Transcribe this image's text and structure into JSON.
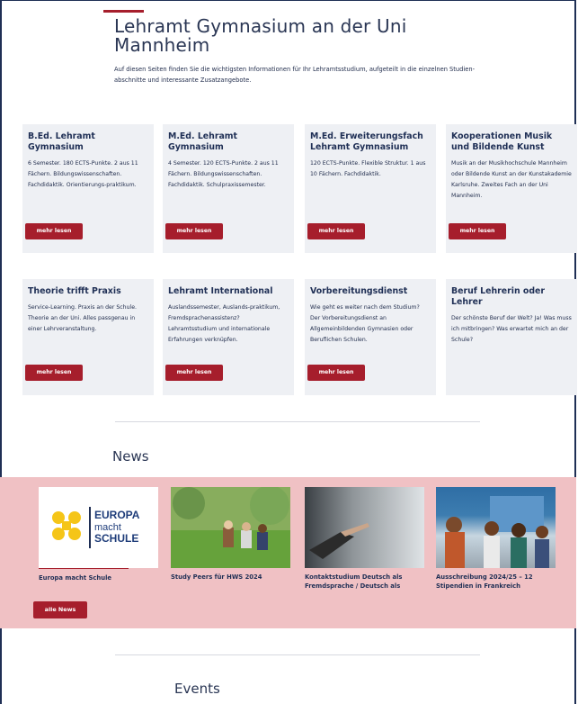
{
  "hero": {
    "title": "Lehramt Gymnasium an der Uni Mannheim",
    "intro": "Auf diesen Seiten finden Sie die wichtigsten Informationen für Ihr Lehramtsstudium, aufgeteilt in die einzelnen Studien-abschnitte und interessante Zusatzangebote."
  },
  "cards": [
    {
      "title": "B.Ed. Lehramt Gymnasium",
      "text": "6 Semester. 180 ECTS-Punkte. 2 aus 11 Fächern. Bildungswissenschaften. Fachdidaktik. Orientierungs-praktikum.",
      "button": "mehr lesen"
    },
    {
      "title": "M.Ed. Lehramt Gymnasium",
      "text": "4 Semester. 120 ECTS-Punkte. 2 aus 11 Fächern. Bildungswissenschaften. Fachdidaktik. Schulpraxissemester.",
      "button": "mehr lesen"
    },
    {
      "title": "M.Ed. Erweiterungsfach Lehramt Gymnasium",
      "text": "120 ECTS-Punkte. Flexible Struktur. 1 aus 10 Fächern. Fachdidaktik.",
      "button": "mehr lesen"
    },
    {
      "title": "Kooperationen Musik und Bildende Kunst",
      "text": "Musik an der Musikhochschule Mannheim oder Bildende Kunst an der Kunstakademie Karlsruhe. Zweites Fach an der Uni Mannheim.",
      "button": "mehr lesen"
    },
    {
      "title": "Theorie trifft Praxis",
      "text": "Service-Learning. Praxis an der Schule. Theorie an der Uni. Alles passgenau in einer Lehrveranstaltung.",
      "button": "mehr lesen"
    },
    {
      "title": "Lehramt International",
      "text": "Auslandssemester, Auslands-praktikum, Fremdsprachenassistenz? Lehramtsstudium und internationale Erfahrungen verknüpfen.",
      "button": "mehr lesen"
    },
    {
      "title": "Vorbereitungsdienst",
      "text": "Wie geht es weiter nach dem Studium? Der Vorbereitungsdienst an Allgemeinbildenden Gymnasien oder Beruflichen Schulen.",
      "button": "mehr lesen"
    },
    {
      "title": "Beruf Lehrerin oder Lehrer",
      "text": "Der schönste Beruf der Welt? Ja! Was muss ich mitbringen? Was erwartet mich an der Schule?",
      "button": ""
    }
  ],
  "news": {
    "heading": "News",
    "items": [
      {
        "caption": "Europa macht Schule",
        "logo_line1": "EUROPA",
        "logo_line2": "macht",
        "logo_line3": "SCHULE"
      },
      {
        "caption": "Study Peers für HWS 2024"
      },
      {
        "caption": "Kontaktstudium Deutsch als Fremdsprache / Deutsch als"
      },
      {
        "caption": "Ausschreibung 2024/25 – 12 Stipendien in Frankreich"
      }
    ],
    "all_button": "alle News"
  },
  "events": {
    "heading": "Events"
  },
  "colors": {
    "accent": "#a61e2c",
    "card_bg": "#eef0f4",
    "news_band": "#f0c1c4",
    "navy": "#1f2f55"
  }
}
